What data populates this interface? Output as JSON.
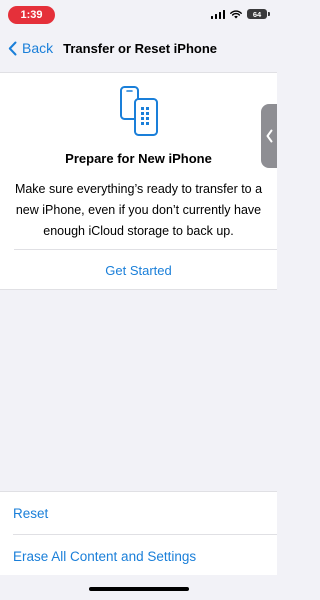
{
  "status_bar": {
    "time": "1:39",
    "battery": "64",
    "accent_color": "#e5303a"
  },
  "nav": {
    "back_label": "Back",
    "title": "Transfer or Reset iPhone"
  },
  "card": {
    "icon": "two-phones-icon",
    "title": "Prepare for New iPhone",
    "description": "Make sure everything’s ready to transfer to a new iPhone, even if you don’t currently have enough iCloud storage to back up.",
    "action_label": "Get Started"
  },
  "bottom_list": {
    "items": [
      {
        "label": "Reset"
      },
      {
        "label": "Erase All Content and Settings"
      }
    ]
  },
  "colors": {
    "link": "#1a7fd9",
    "background": "#f2f2f7"
  }
}
